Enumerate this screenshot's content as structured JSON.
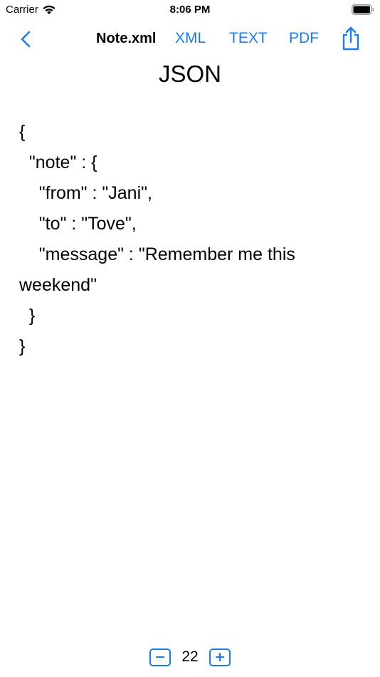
{
  "status_bar": {
    "carrier": "Carrier",
    "time": "8:06 PM"
  },
  "nav": {
    "title": "Note.xml",
    "links": [
      "XML",
      "TEXT",
      "PDF"
    ]
  },
  "page": {
    "heading": "JSON"
  },
  "content": {
    "text": "{\n  \"note\" : {\n    \"from\" : \"Jani\",\n    \"to\" : \"Tove\",\n    \"message\" : \"Remember me this weekend\"\n  }\n}"
  },
  "stepper": {
    "value": "22"
  },
  "colors": {
    "accent": "#1a7cf0"
  },
  "icons": [
    "wifi-icon",
    "battery-icon",
    "chevron-left-icon",
    "share-icon",
    "minus-icon",
    "plus-icon"
  ]
}
